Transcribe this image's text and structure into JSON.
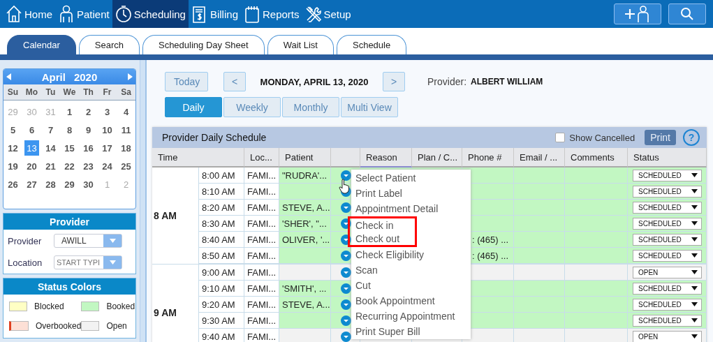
{
  "nav": {
    "items": [
      {
        "label": "Home",
        "kind": "home",
        "selected": false
      },
      {
        "label": "Patient",
        "kind": "person",
        "selected": false
      },
      {
        "label": "Scheduling",
        "kind": "clock",
        "selected": true
      },
      {
        "label": "Billing",
        "kind": "bill",
        "selected": false
      },
      {
        "label": "Reports",
        "kind": "notepad",
        "selected": false
      },
      {
        "label": "Setup",
        "kind": "tools",
        "selected": false
      }
    ]
  },
  "tabs": [
    {
      "label": "Calendar",
      "selected": true
    },
    {
      "label": "Search",
      "selected": false
    },
    {
      "label": "Scheduling Day Sheet",
      "selected": false
    },
    {
      "label": "Wait List",
      "selected": false
    },
    {
      "label": "Schedule",
      "selected": false
    }
  ],
  "calendar": {
    "month": "April",
    "year": "2020",
    "weekdays": [
      "Su",
      "Mo",
      "Tu",
      "We",
      "Th",
      "Fr",
      "Sa"
    ],
    "days": [
      {
        "label": "29",
        "muted": true,
        "selected": false
      },
      {
        "label": "30",
        "muted": true,
        "selected": false
      },
      {
        "label": "31",
        "muted": true,
        "selected": false
      },
      {
        "label": "1",
        "muted": false,
        "selected": false
      },
      {
        "label": "2",
        "muted": false,
        "selected": false
      },
      {
        "label": "3",
        "muted": false,
        "selected": false
      },
      {
        "label": "4",
        "muted": false,
        "selected": false
      },
      {
        "label": "5",
        "muted": false,
        "selected": false
      },
      {
        "label": "6",
        "muted": false,
        "selected": false
      },
      {
        "label": "7",
        "muted": false,
        "selected": false
      },
      {
        "label": "8",
        "muted": false,
        "selected": false
      },
      {
        "label": "9",
        "muted": false,
        "selected": false
      },
      {
        "label": "10",
        "muted": false,
        "selected": false
      },
      {
        "label": "11",
        "muted": false,
        "selected": false
      },
      {
        "label": "12",
        "muted": false,
        "selected": false
      },
      {
        "label": "13",
        "muted": false,
        "selected": true
      },
      {
        "label": "14",
        "muted": false,
        "selected": false
      },
      {
        "label": "15",
        "muted": false,
        "selected": false
      },
      {
        "label": "16",
        "muted": false,
        "selected": false
      },
      {
        "label": "17",
        "muted": false,
        "selected": false
      },
      {
        "label": "18",
        "muted": false,
        "selected": false
      },
      {
        "label": "19",
        "muted": false,
        "selected": false
      },
      {
        "label": "20",
        "muted": false,
        "selected": false
      },
      {
        "label": "21",
        "muted": false,
        "selected": false
      },
      {
        "label": "22",
        "muted": false,
        "selected": false
      },
      {
        "label": "23",
        "muted": false,
        "selected": false
      },
      {
        "label": "24",
        "muted": false,
        "selected": false
      },
      {
        "label": "25",
        "muted": false,
        "selected": false
      },
      {
        "label": "26",
        "muted": false,
        "selected": false
      },
      {
        "label": "27",
        "muted": false,
        "selected": false
      },
      {
        "label": "28",
        "muted": false,
        "selected": false
      },
      {
        "label": "29",
        "muted": false,
        "selected": false
      },
      {
        "label": "30",
        "muted": false,
        "selected": false
      },
      {
        "label": "1",
        "muted": true,
        "selected": false
      },
      {
        "label": "2",
        "muted": true,
        "selected": false
      }
    ]
  },
  "provider_panel": {
    "title": "Provider",
    "provider_label": "Provider",
    "provider_value": "AWILL",
    "location_label": "Location",
    "location_placeholder": "START TYPI"
  },
  "status_colors": {
    "title": "Status Colors",
    "items": [
      {
        "label": "Blocked",
        "color": "#ffffc4"
      },
      {
        "label": "Booked",
        "color": "#c2f7c2"
      },
      {
        "label": "Overbooked",
        "color": "#fde0d6"
      },
      {
        "label": "Open",
        "color": "#f2f2f2"
      }
    ]
  },
  "toolbar": {
    "today": "Today",
    "prev": "<",
    "date": "MONDAY, APRIL 13, 2020",
    "next": ">",
    "provider_label": "Provider:",
    "provider_name": "ALBERT WILLIAM",
    "views": [
      {
        "label": "Daily",
        "selected": true
      },
      {
        "label": "Weekly",
        "selected": false
      },
      {
        "label": "Monthly",
        "selected": false
      },
      {
        "label": "Multi View",
        "selected": false
      }
    ]
  },
  "schedule": {
    "title": "Provider Daily Schedule",
    "show_cancelled": {
      "label": "Show Cancelled",
      "checked": false
    },
    "print": "Print",
    "help": "?",
    "columns": [
      "Time",
      "Loc...",
      "Patient",
      "Reason",
      "Plan / C...",
      "Phone #",
      "Email / ...",
      "Comments",
      "Status"
    ],
    "hours": [
      {
        "label": "8 AM",
        "slots": [
          {
            "time": "8:00 AM",
            "location": "FAMI...",
            "patient": "\"RUDRA'...",
            "booked": true,
            "status": "SCHEDULED"
          },
          {
            "time": "8:10 AM",
            "location": "FAMI...",
            "booked": true,
            "status": "SCHEDULED"
          },
          {
            "time": "8:20 AM",
            "location": "FAMI...",
            "patient": "STEVE, A...",
            "booked": true,
            "status": "SCHEDULED"
          },
          {
            "time": "8:30 AM",
            "location": "FAMI...",
            "patient": "'SHER', \"...",
            "booked": true,
            "status": "SCHEDULED"
          },
          {
            "time": "8:40 AM",
            "location": "FAMI...",
            "patient": "OLIVER, '...",
            "phone": ": (465) ...",
            "booked": true,
            "status": "SCHEDULED"
          },
          {
            "time": "8:50 AM",
            "location": "FAMI...",
            "phone": ": (465) ...",
            "booked": true,
            "status": "SCHEDULED"
          }
        ]
      },
      {
        "label": "9 AM",
        "slots": [
          {
            "time": "9:00 AM",
            "location": "FAMI...",
            "booked": false,
            "status": "OPEN"
          },
          {
            "time": "9:10 AM",
            "location": "FAMI...",
            "patient": "'SMITH', ...",
            "booked": true,
            "status": "SCHEDULED"
          },
          {
            "time": "9:20 AM",
            "location": "FAMI...",
            "patient": "STEVE, A...",
            "booked": true,
            "status": "SCHEDULED"
          },
          {
            "time": "9:30 AM",
            "location": "FAMI...",
            "booked": true,
            "status": "SCHEDULED"
          },
          {
            "time": "9:40 AM",
            "location": "FAMI...",
            "booked": false,
            "status": "OPEN"
          }
        ]
      }
    ]
  },
  "context_menu": {
    "items": [
      {
        "label": "Select Patient",
        "boxed": false
      },
      {
        "label": "Print Label",
        "boxed": false
      },
      {
        "label": "Appointment Detail",
        "boxed": false
      },
      {
        "label": "Check in",
        "boxed": true
      },
      {
        "label": "Check out",
        "boxed": true
      },
      {
        "label": "Check Eligibility",
        "boxed": false
      },
      {
        "label": "Scan",
        "boxed": false
      },
      {
        "label": "Cut",
        "boxed": false
      },
      {
        "label": "Book Appointment",
        "boxed": false
      },
      {
        "label": "Recurring Appointment",
        "boxed": false
      },
      {
        "label": "Print Super Bill",
        "boxed": false
      }
    ]
  }
}
